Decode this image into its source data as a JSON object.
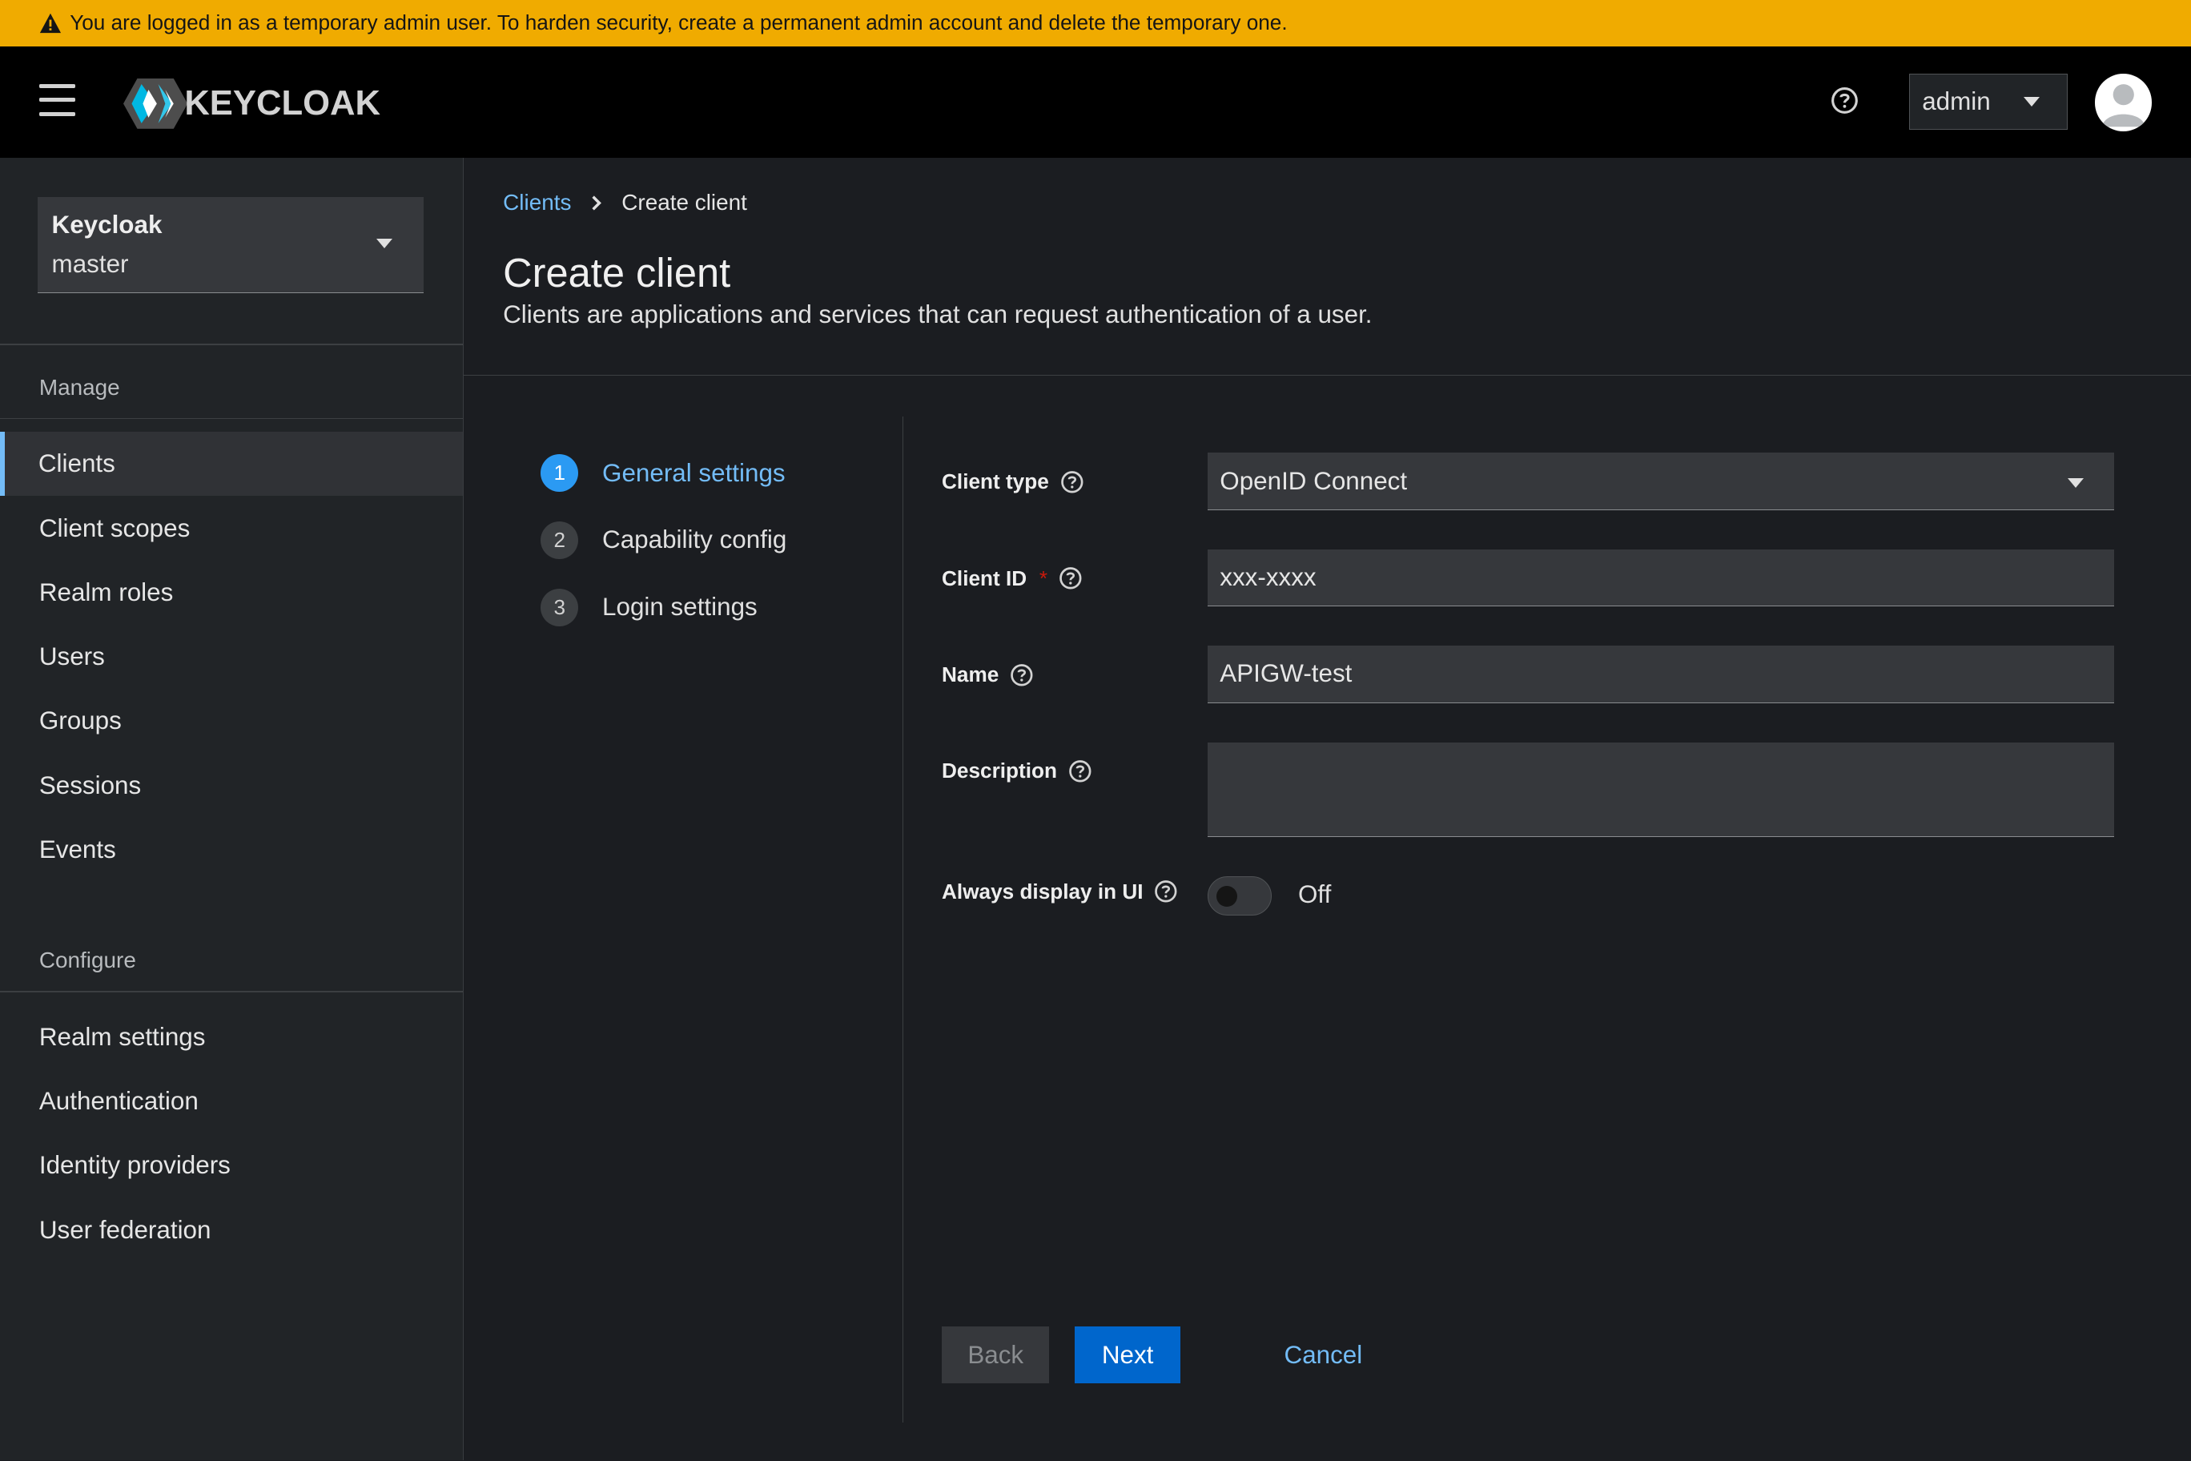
{
  "banner": {
    "text": "You are logged in as a temporary admin user. To harden security, create a permanent admin account and delete the temporary one."
  },
  "header": {
    "logo_text": "KEYCLOAK",
    "user": "admin"
  },
  "realm": {
    "name": "Keycloak",
    "value": "master"
  },
  "sidebar": {
    "manage_title": "Manage",
    "manage_items": [
      "Clients",
      "Client scopes",
      "Realm roles",
      "Users",
      "Groups",
      "Sessions",
      "Events"
    ],
    "configure_title": "Configure",
    "configure_items": [
      "Realm settings",
      "Authentication",
      "Identity providers",
      "User federation"
    ]
  },
  "breadcrumb": {
    "parent": "Clients",
    "current": "Create client"
  },
  "page": {
    "title": "Create client",
    "subtitle": "Clients are applications and services that can request authentication of a user."
  },
  "steps": [
    {
      "num": "1",
      "label": "General settings"
    },
    {
      "num": "2",
      "label": "Capability config"
    },
    {
      "num": "3",
      "label": "Login settings"
    }
  ],
  "form": {
    "client_type": {
      "label": "Client type",
      "value": "OpenID Connect"
    },
    "client_id": {
      "label": "Client ID",
      "required_mark": "*",
      "value": "xxx-xxxx"
    },
    "name": {
      "label": "Name",
      "value": "APIGW-test"
    },
    "description": {
      "label": "Description",
      "value": ""
    },
    "always_display": {
      "label": "Always display in UI",
      "state": "Off"
    }
  },
  "buttons": {
    "back": "Back",
    "next": "Next",
    "cancel": "Cancel"
  }
}
